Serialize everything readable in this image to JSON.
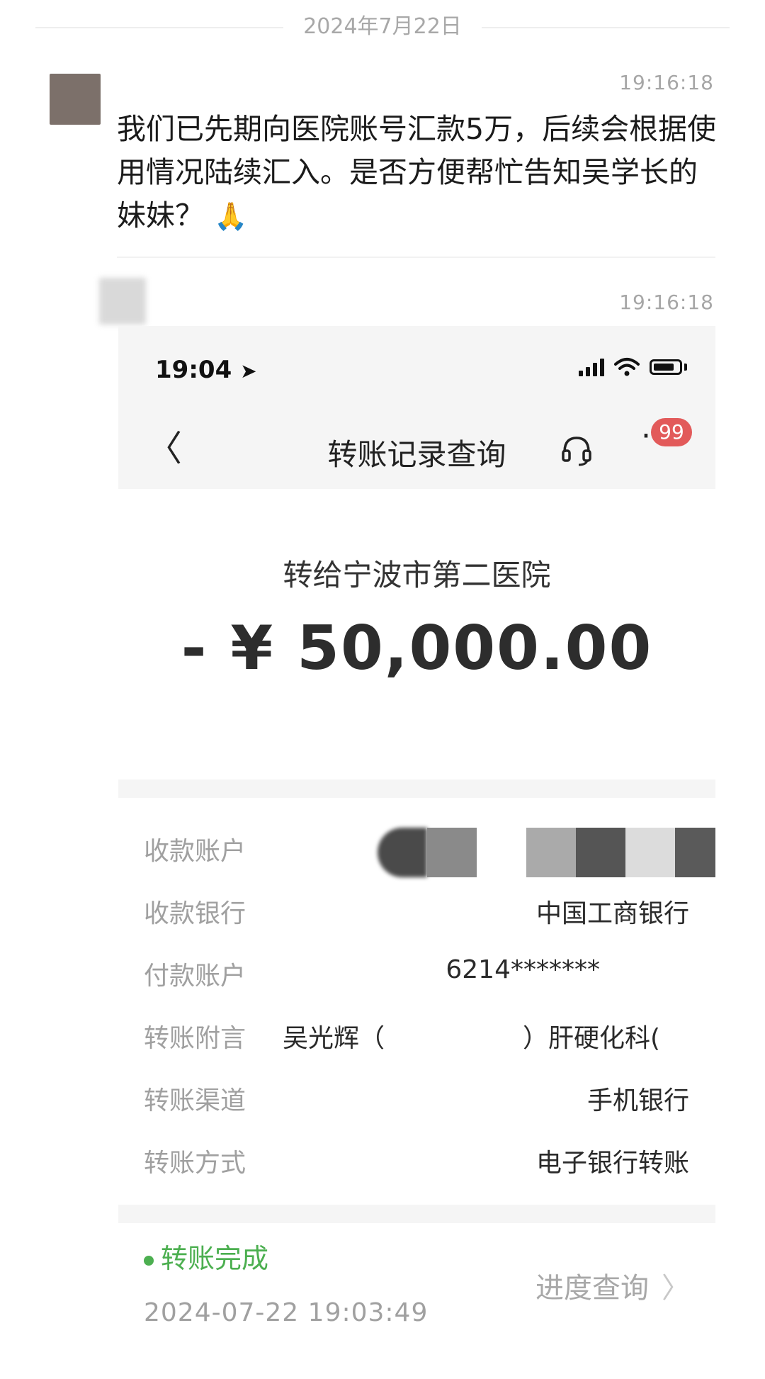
{
  "chat": {
    "date": "2024年7月22日",
    "messages": [
      {
        "time": "19:16:18",
        "text": "我们已先期向医院账号汇款5万，后续会根据使用情况陆续汇入。是否方便帮忙告知吴学长的妹妹？",
        "emoji_icon": "pray-emoji-icon"
      },
      {
        "time": "19:16:18"
      }
    ]
  },
  "screenshot": {
    "status_bar": {
      "time": "19:04"
    },
    "nav": {
      "title": "转账记录查询",
      "badge": "99"
    },
    "transfer": {
      "to_text": "转给宁波市第二医院",
      "amount": "- ¥ 50,000.00"
    },
    "details": [
      {
        "label": "收款账户",
        "value": ""
      },
      {
        "label": "收款银行",
        "value": "中国工商银行"
      },
      {
        "label": "付款账户",
        "value": "6214*******"
      },
      {
        "label": "转账附言",
        "value_left": "吴光辉（",
        "value_right": "）肝硬化科("
      },
      {
        "label": "转账渠道",
        "value": "手机银行"
      },
      {
        "label": "转账方式",
        "value": "电子银行转账"
      }
    ],
    "status": {
      "text": "转账完成",
      "datetime": "2024-07-22 19:03:49",
      "status_color": "#4caf50",
      "progress_link": "进度查询"
    }
  }
}
